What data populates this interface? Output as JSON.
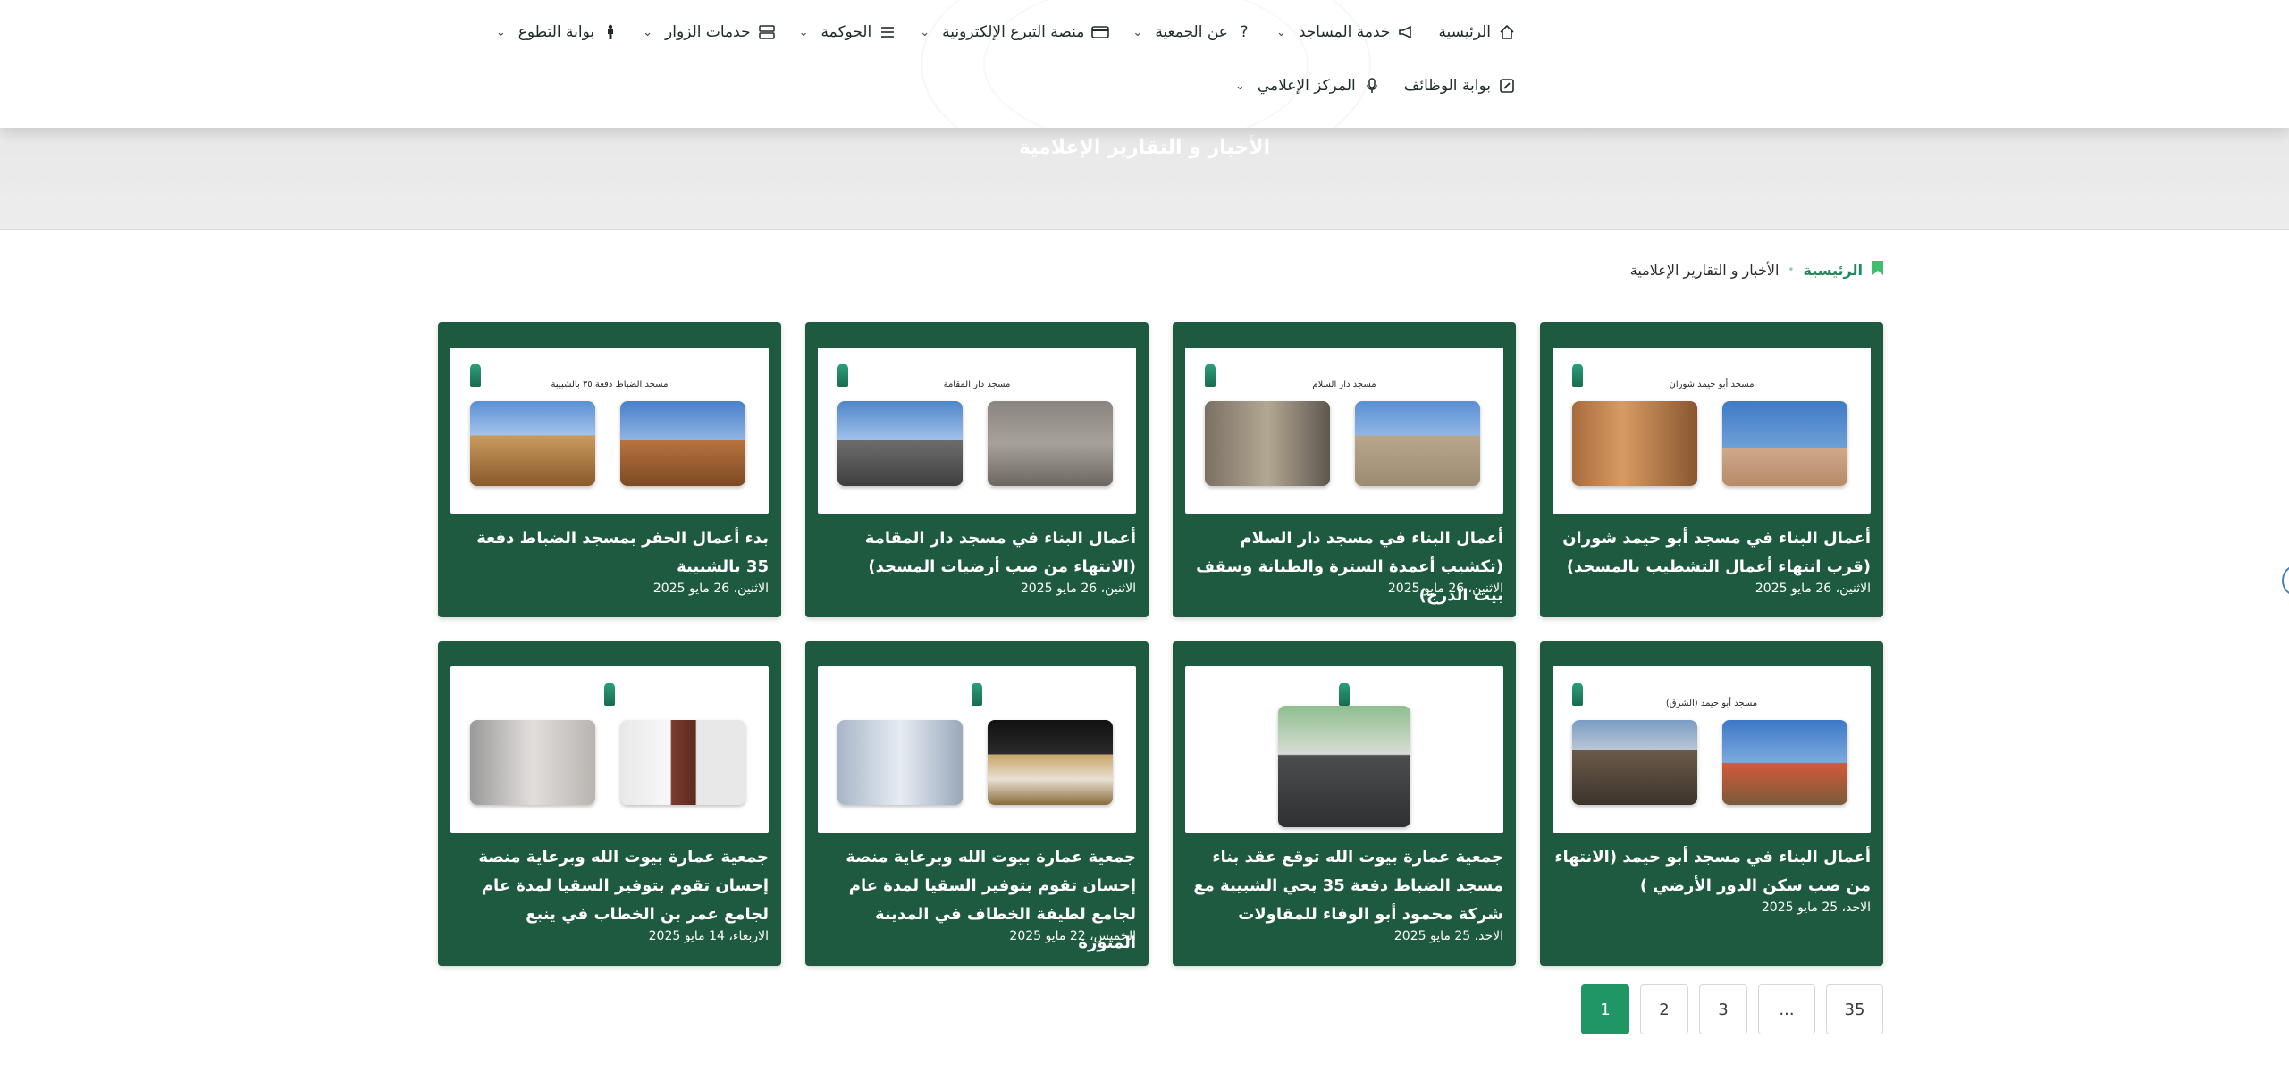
{
  "nav": {
    "row1": [
      {
        "label": "الرئيسية",
        "icon": "home-icon",
        "dropdown": false
      },
      {
        "label": "خدمة المساجد",
        "icon": "megaphone-icon",
        "dropdown": true
      },
      {
        "label": "عن الجمعية",
        "icon": "question-icon",
        "dropdown": true
      },
      {
        "label": "منصة التبرع الإلكترونية",
        "icon": "card-icon",
        "dropdown": true
      },
      {
        "label": "الحوكمة",
        "icon": "list-icon",
        "dropdown": true
      },
      {
        "label": "خدمات الزوار",
        "icon": "server-icon",
        "dropdown": true
      },
      {
        "label": "بوابة التطوع",
        "icon": "person-icon",
        "dropdown": true
      }
    ],
    "row2": [
      {
        "label": "بوابة الوظائف",
        "icon": "edit-icon",
        "dropdown": false
      },
      {
        "label": "المركز الإعلامي",
        "icon": "microphone-icon",
        "dropdown": true
      }
    ]
  },
  "banner": {
    "title": "الأخبار و التقارير الإعلامية"
  },
  "breadcrumb": {
    "home": "الرئيسية",
    "current": "الأخبار و التقارير الإعلامية"
  },
  "cards": [
    {
      "title": "أعمال البناء في مسجد أبو حيمد شوران (قرب انتهاء أعمال التشطيب بالمسجد)",
      "date": "الاثنين، 26 مايو 2025",
      "caption": "مسجد أبو حيمد شوران"
    },
    {
      "title": "أعمال البناء في مسجد دار السلام (تكشيب أعمدة السترة والطبانة وسقف بيت الدرج)",
      "date": "الاثنين، 26 مايو 2025",
      "caption": "مسجد دار السلام"
    },
    {
      "title": "أعمال البناء في مسجد دار المقامة (الانتهاء من صب أرضيات المسجد)",
      "date": "الاثنين، 26 مايو 2025",
      "caption": "مسجد دار المقامة"
    },
    {
      "title": "بدء أعمال الحفر بمسجد الضباط دفعة 35 بالشبيبة",
      "date": "الاثنين، 26 مايو 2025",
      "caption": "مسجد الضباط دفعة ٣٥ بالشبيبة"
    },
    {
      "title": "أعمال البناء في مسجد أبو حيمد (الانتهاء من صب سكن الدور الأرضي )",
      "date": "الاحد، 25 مايو 2025",
      "caption": "مسجد أبو حيمد (الشرق)"
    },
    {
      "title": "جمعية عمارة بيوت الله توقع عقد بناء مسجد الضباط دفعة 35 بحي الشبيبة مع شركة محمود أبو الوفاء للمقاولات",
      "date": "الاحد، 25 مايو 2025",
      "caption": ""
    },
    {
      "title": "جمعية عمارة بيوت الله وبرعاية منصة إحسان تقوم بتوفير السقيا لمدة عام لجامع لطيفة الخطاف في المدينة المنورة",
      "date": "الخميس، 22 مايو 2025",
      "caption": ""
    },
    {
      "title": "جمعية عمارة بيوت الله وبرعاية منصة إحسان تقوم بتوفير السقيا لمدة عام لجامع عمر بن الخطاب في ينبع",
      "date": "الاربعاء، 14 مايو 2025",
      "caption": ""
    }
  ],
  "pagination": {
    "pages": [
      "1",
      "2",
      "3",
      "...",
      "35"
    ],
    "active": "1"
  },
  "colors": {
    "card_bg": "#1e5a40",
    "accent": "#1f9664",
    "tab_accent": "#27b08a"
  }
}
